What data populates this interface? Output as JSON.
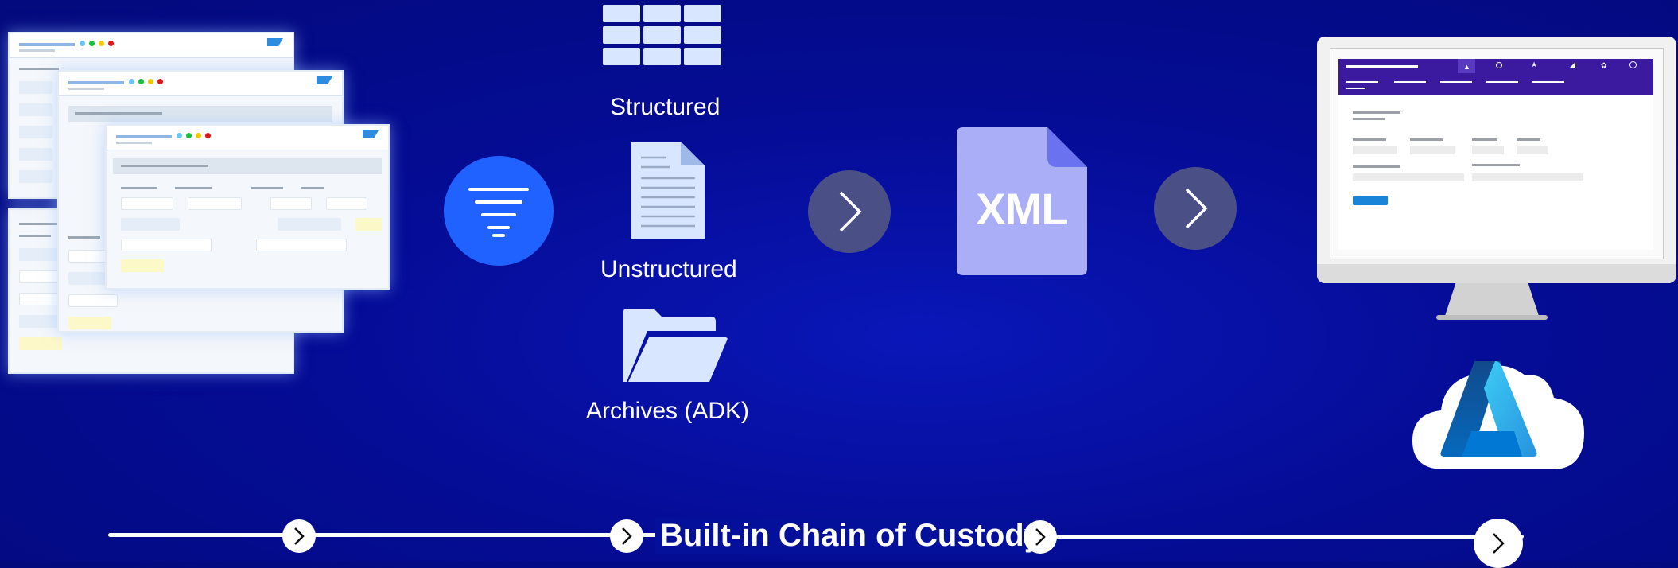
{
  "sources": {
    "structured_label": "Structured",
    "unstructured_label": "Unstructured",
    "archives_label": "Archives (ADK)"
  },
  "xml_doc": {
    "label": "XML"
  },
  "footer": {
    "chain_label": "Built-in Chain of Custody"
  },
  "colors": {
    "background": "#050c96",
    "filter_circle": "#1f62ff",
    "arrow_circle": "#4a4f86",
    "xml_doc": "#a9aef7",
    "xml_fold": "#6a72f0",
    "icon_light": "#d8e6ff",
    "monitor_header": "#3c1aa0"
  },
  "icons": [
    "filter-icon",
    "table-icon",
    "document-icon",
    "folder-icon",
    "xml-file-icon",
    "monitor-icon",
    "azure-cloud-icon",
    "chevron-right-icon"
  ]
}
